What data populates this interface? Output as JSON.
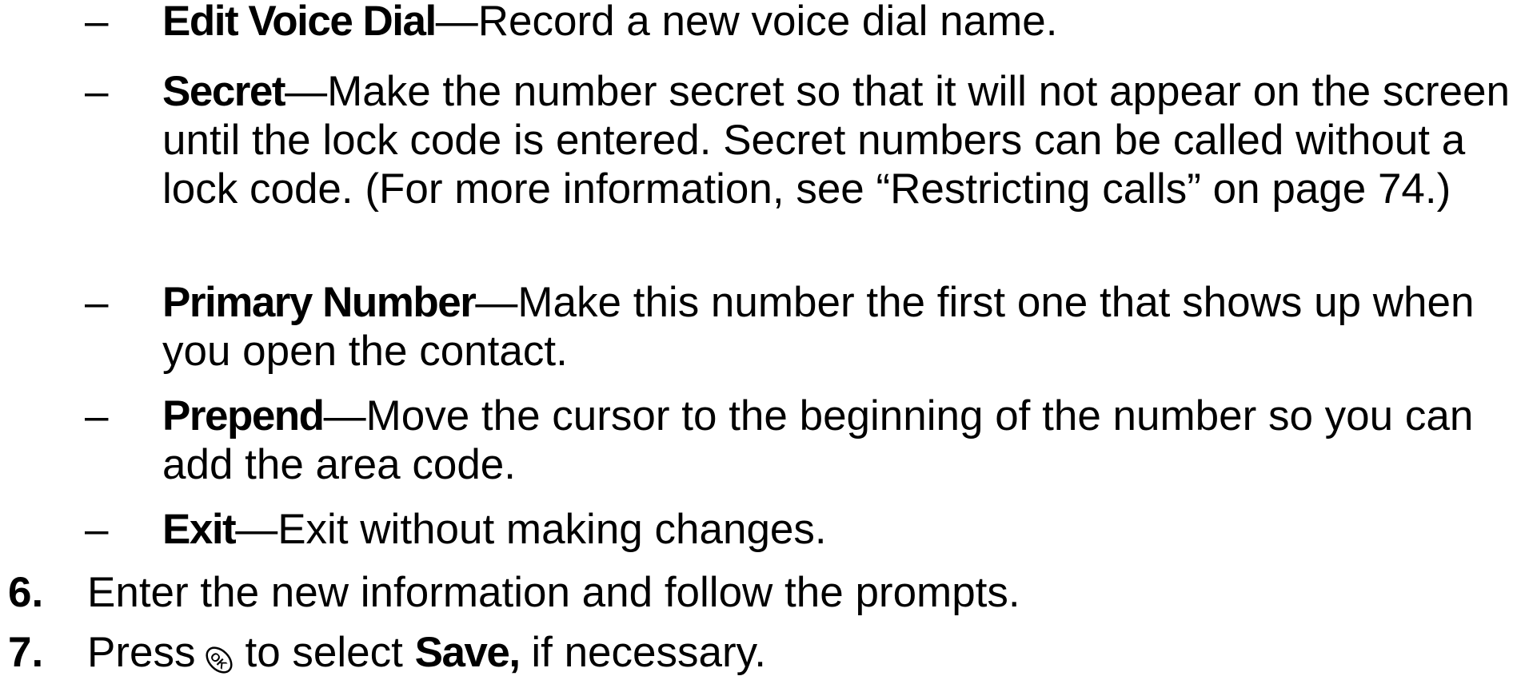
{
  "sub_items": [
    {
      "dash": "–",
      "term": "Edit Voice Dial",
      "emdash": "—",
      "desc": "Record a new voice dial name."
    },
    {
      "dash": "–",
      "term": "Secret",
      "emdash": "—",
      "desc": "Make the number secret so that it will not appear on the screen until the lock code is entered. Secret numbers can be called without a lock code. (For more information, see “Restricting calls” on page 74.)"
    },
    {
      "dash": "–",
      "term": "Primary Number",
      "emdash": "—",
      "desc": "Make this number the first one that shows up when you open the contact."
    },
    {
      "dash": "–",
      "term": "Prepend",
      "emdash": "—",
      "desc": "Move the cursor to the beginning of the number so you can add the area code."
    },
    {
      "dash": "–",
      "term": "Exit",
      "emdash": "—",
      "desc": "Exit without making changes."
    }
  ],
  "steps": [
    {
      "number": "6.",
      "text": "Enter the new information and follow the prompts."
    },
    {
      "number": "7.",
      "text_before_icon": "Press",
      "icon": "ok-key-icon",
      "icon_text": "OK",
      "text_after_icon": "to select",
      "term": "Save,",
      "text_end": "if necessary."
    }
  ]
}
